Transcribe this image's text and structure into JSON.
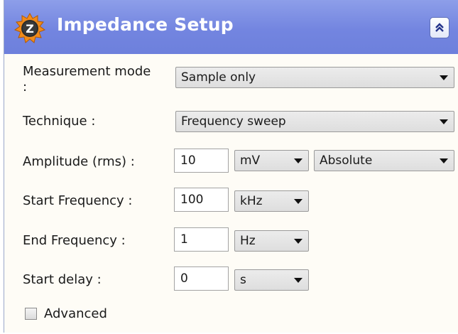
{
  "header": {
    "title": "Impedance Setup",
    "logo_letter": "Z",
    "logo_icon": "gear-z-logo-icon",
    "collapse_icon": "double-chevron-up-icon"
  },
  "form": {
    "measurement_mode": {
      "label": "Measurement mode :",
      "value": "Sample only"
    },
    "technique": {
      "label": "Technique :",
      "value": "Frequency sweep"
    },
    "amplitude": {
      "label": "Amplitude (rms) :",
      "value": "10",
      "unit": "mV",
      "mode": "Absolute"
    },
    "start_frequency": {
      "label": "Start Frequency :",
      "value": "100",
      "unit": "kHz"
    },
    "end_frequency": {
      "label": "End Frequency :",
      "value": "1",
      "unit": "Hz"
    },
    "start_delay": {
      "label": "Start delay :",
      "value": "0",
      "unit": "s"
    },
    "advanced": {
      "label": "Advanced",
      "checked": false
    }
  },
  "colors": {
    "header_bg": "#7385e0",
    "header_text": "#ffffff",
    "panel_bg": "#fefcf6",
    "logo_orange": "#f08a1a"
  }
}
